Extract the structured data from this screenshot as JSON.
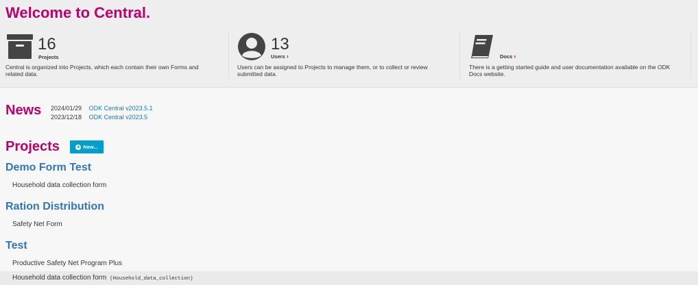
{
  "hero": {
    "title": "Welcome to Central.",
    "summaries": [
      {
        "count": "16",
        "label": "Projects",
        "description": "Central is organized into Projects, which each contain their own Forms and related data.",
        "icon": "archive-box-icon"
      },
      {
        "count": "13",
        "label": "Users",
        "description": "Users can be assigned to Projects to manage them, or to collect or review submitted data.",
        "icon": "user-circle-icon"
      },
      {
        "count": "",
        "label": "Docs",
        "description": "There is a getting started guide and user documentation available on the ODK Docs website.",
        "icon": "book-icon"
      }
    ],
    "chevron": "›"
  },
  "news": {
    "heading": "News",
    "items": [
      {
        "date": "2024/01/29",
        "title": "ODK Central v2023.5.1"
      },
      {
        "date": "2023/12/18",
        "title": "ODK Central v2023.5"
      }
    ]
  },
  "projects": {
    "heading": "Projects",
    "new_label": "New...",
    "plus": "+",
    "list": [
      {
        "name": "Demo Form Test",
        "forms": [
          {
            "name": "Household data collection form",
            "id": ""
          }
        ]
      },
      {
        "name": "Ration Distribution",
        "forms": [
          {
            "name": "Safety Net Form",
            "id": ""
          }
        ]
      },
      {
        "name": "Test",
        "forms": [
          {
            "name": "Productive Safety Net Program Plus",
            "id": ""
          },
          {
            "name": "Household data collection form",
            "id": "(Household_data_collection)"
          }
        ]
      }
    ]
  },
  "colors": {
    "accent": "#bd006b",
    "link": "#2e77bc",
    "button": "#009ecc"
  }
}
